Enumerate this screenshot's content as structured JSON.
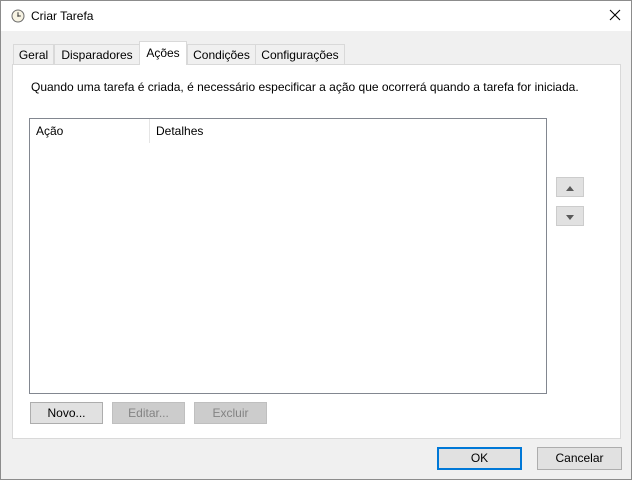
{
  "window": {
    "title": "Criar Tarefa"
  },
  "tabs": [
    {
      "label": "Geral"
    },
    {
      "label": "Disparadores"
    },
    {
      "label": "Ações"
    },
    {
      "label": "Condições"
    },
    {
      "label": "Configurações"
    }
  ],
  "active_tab": "Ações",
  "panel": {
    "description": "Quando uma tarefa é criada, é necessário especificar a ação que ocorrerá quando a tarefa for iniciada.",
    "columns": [
      "Ação",
      "Detalhes"
    ],
    "rows": []
  },
  "actions": {
    "new_label": "Novo...",
    "edit_label": "Editar...",
    "delete_label": "Excluir"
  },
  "footer": {
    "ok_label": "OK",
    "cancel_label": "Cancelar"
  },
  "icons": {
    "title": "clock-icon",
    "close": "close-icon",
    "move_up": "arrow-up-icon",
    "move_down": "arrow-down-icon"
  },
  "colors": {
    "accent": "#0078d7"
  }
}
